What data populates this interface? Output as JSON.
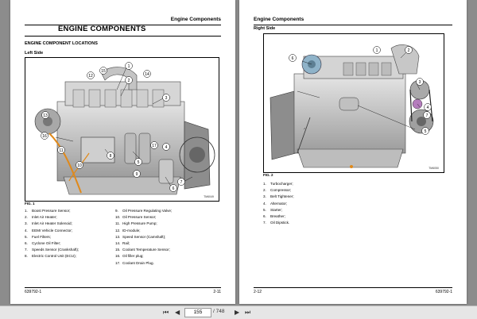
{
  "left_page": {
    "header": "Engine Components",
    "main_title": "ENGINE COMPONENTS",
    "section_title": "ENGINE COMPONENT LOCATIONS",
    "subtitle": "Left Side",
    "fig_label": "FIG. 1",
    "fig_code": "TM6049",
    "callouts": [
      "1",
      "2",
      "3",
      "4",
      "5",
      "6",
      "7",
      "8",
      "9",
      "10",
      "11",
      "12",
      "13",
      "14",
      "15",
      "16",
      "17"
    ],
    "legend_col1": [
      {
        "n": "1.",
        "t": "Boost Pressure Sensor;"
      },
      {
        "n": "2.",
        "t": "Inlet Air Heater;"
      },
      {
        "n": "3.",
        "t": "Inlet Air Heater Solenoid;"
      },
      {
        "n": "4.",
        "t": "EEMI Vehicle Connector;"
      },
      {
        "n": "5.",
        "t": "Fuel Filters;"
      },
      {
        "n": "6.",
        "t": "Cyclone Oil Filter;"
      },
      {
        "n": "7.",
        "t": "Speeds Sensor (Crankshaft);"
      },
      {
        "n": "8.",
        "t": "Electric Control Unit (ECU);"
      }
    ],
    "legend_col2": [
      {
        "n": "9.",
        "t": "Oil Pressure Regulating Valve;"
      },
      {
        "n": "10.",
        "t": "Oil Pressure Sensor;"
      },
      {
        "n": "11.",
        "t": "High Pressure Pump;"
      },
      {
        "n": "12.",
        "t": "ID-module;"
      },
      {
        "n": "13.",
        "t": "Speed Sensor (Camshaft);"
      },
      {
        "n": "14.",
        "t": "Rail;"
      },
      {
        "n": "15.",
        "t": "Coolant Temperature Sensor;"
      },
      {
        "n": "16.",
        "t": "Oil filler plug;"
      },
      {
        "n": "17.",
        "t": "Coolant Drain Plug."
      }
    ],
    "footer_left": "639792-1",
    "footer_right": "2-11"
  },
  "right_page": {
    "header": "Engine Components",
    "subtitle": "Right Side",
    "fig_label": "FIG. 2",
    "fig_code": "TM6050",
    "callouts": [
      "1",
      "2",
      "3",
      "4",
      "5",
      "6",
      "7"
    ],
    "legend": [
      {
        "n": "1.",
        "t": "Turbocharger;"
      },
      {
        "n": "2.",
        "t": "Compressor;"
      },
      {
        "n": "3.",
        "t": "Belt Tightener;"
      },
      {
        "n": "4.",
        "t": "Alternator;"
      },
      {
        "n": "5.",
        "t": "Starter;"
      },
      {
        "n": "6.",
        "t": "Breather;"
      },
      {
        "n": "7.",
        "t": "Oil Dipstick."
      }
    ],
    "footer_left": "2-12",
    "footer_right": "639792-1"
  },
  "toolbar": {
    "first_icon": "first-page-icon",
    "prev_icon": "prev-page-icon",
    "next_icon": "next-page-icon",
    "last_icon": "last-page-icon",
    "current_page": "155",
    "total_pages": "/ 748"
  }
}
